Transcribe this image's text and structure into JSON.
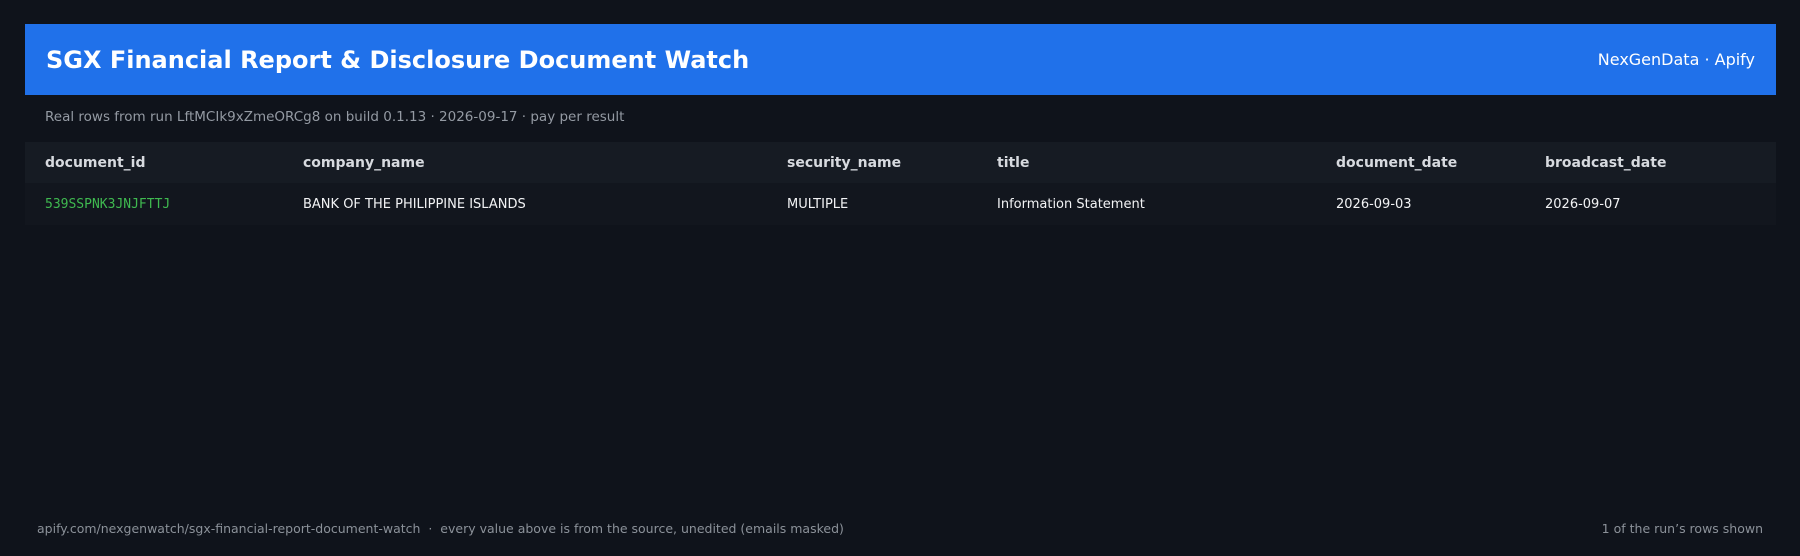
{
  "header": {
    "title": "SGX Financial Report & Disclosure Document Watch",
    "brand": "NexGenData · Apify"
  },
  "subtitle": "Real rows from run LftMCIk9xZmeORCg8 on build 0.1.13 · 2026-09-17 · pay per result",
  "table": {
    "columns": [
      "document_id",
      "company_name",
      "security_name",
      "title",
      "document_date",
      "broadcast_date"
    ],
    "rows": [
      {
        "document_id": "539SSPNK3JNJFTTJ",
        "company_name": "BANK OF THE PHILIPPINE ISLANDS",
        "security_name": "MULTIPLE",
        "title": "Information Statement",
        "document_date": "2026-09-03",
        "broadcast_date": "2026-09-07"
      }
    ]
  },
  "footer": {
    "left": "apify.com/nexgenwatch/sgx-financial-report-document-watch  ·  every value above is from the source, unedited (emails masked)",
    "right": "1 of the run’s rows shown"
  },
  "colors": {
    "background": "#0f131b",
    "header_bg": "#2071ea",
    "id_text": "#3fb950"
  }
}
